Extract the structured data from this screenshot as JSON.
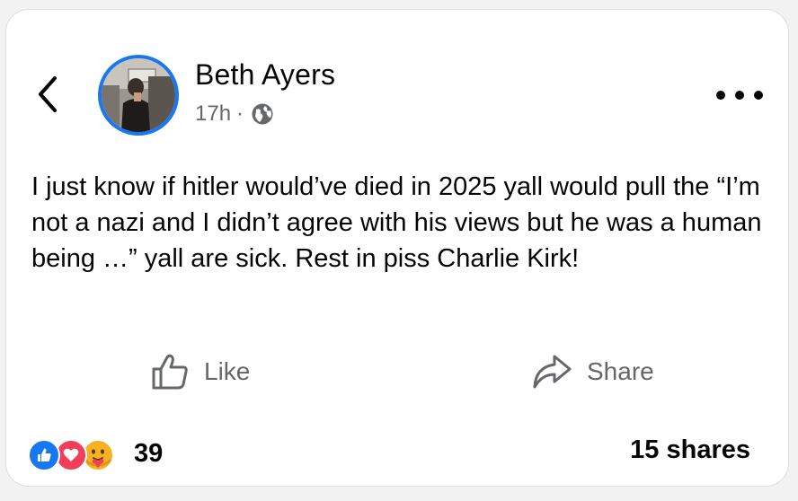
{
  "post": {
    "author_name": "Beth Ayers",
    "time_ago": "17h",
    "separator": "·",
    "privacy_icon": "globe-icon",
    "body": "I just know if hitler would’ve died in 2025 yall would pull the “I’m not a nazi and I didn’t agree with his views but he was a human being …” yall are sick. Rest in piss Charlie Kirk!"
  },
  "actions": {
    "like_label": "Like",
    "share_label": "Share"
  },
  "footer": {
    "reaction_count": "39",
    "reaction_icons": [
      "like-reaction-icon",
      "love-reaction-icon",
      "care-reaction-icon"
    ],
    "shares_text": "15 shares"
  },
  "colors": {
    "accent_blue": "#1877f2",
    "love_red": "#f33e58",
    "care_yellow": "#f7b125",
    "secondary_text": "#65676b"
  }
}
